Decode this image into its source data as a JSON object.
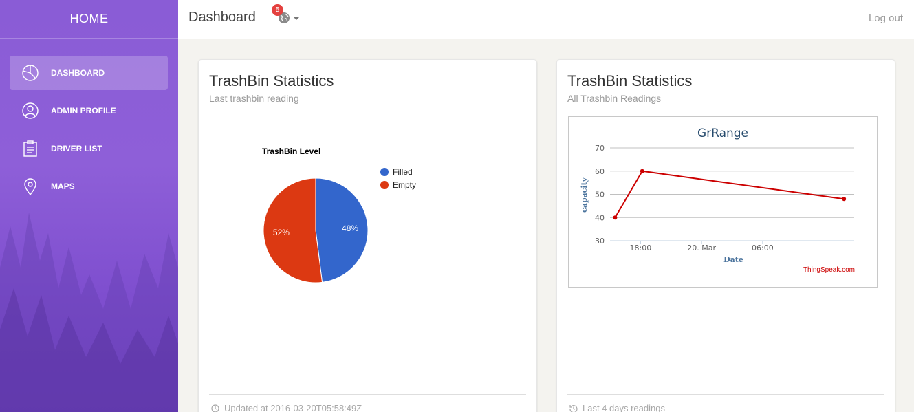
{
  "sidebar": {
    "home_label": "HOME",
    "items": [
      {
        "label": "DASHBOARD",
        "icon": "pie-chart-icon",
        "active": true
      },
      {
        "label": "ADMIN PROFILE",
        "icon": "user-icon",
        "active": false
      },
      {
        "label": "DRIVER LIST",
        "icon": "clipboard-icon",
        "active": false
      },
      {
        "label": "MAPS",
        "icon": "map-pin-icon",
        "active": false
      }
    ]
  },
  "topbar": {
    "title": "Dashboard",
    "notification_count": "5",
    "logout_label": "Log out"
  },
  "cards": {
    "left": {
      "title": "TrashBin Statistics",
      "subtitle": "Last trashbin reading",
      "footer": "Updated at 2016-03-20T05:58:49Z"
    },
    "right": {
      "title": "TrashBin Statistics",
      "subtitle": "All Trashbin Readings",
      "footer": "Last 4 days readings"
    }
  },
  "colors": {
    "filled": "#3366cc",
    "empty": "#dc3912",
    "line": "#cc0000",
    "accent_purple": "#8a5cd6"
  },
  "chart_data": [
    {
      "type": "pie",
      "title": "TrashBin Level",
      "labels": [
        "Filled",
        "Empty"
      ],
      "values": [
        48,
        52
      ],
      "value_labels": [
        "48%",
        "52%"
      ],
      "legend": "top-right"
    },
    {
      "type": "line",
      "title": "GrRange",
      "xlabel": "Date",
      "ylabel": "capacity",
      "x_ticks": [
        "18:00",
        "20. Mar",
        "06:00"
      ],
      "x": [
        "2016-03-19T15:30",
        "2016-03-19T18:10",
        "2016-03-20T14:00"
      ],
      "y": [
        40,
        60,
        48
      ],
      "ylim": [
        30,
        70
      ],
      "y_ticks": [
        30,
        40,
        50,
        60,
        70
      ],
      "grid": true,
      "credit": "ThingSpeak.com"
    }
  ]
}
